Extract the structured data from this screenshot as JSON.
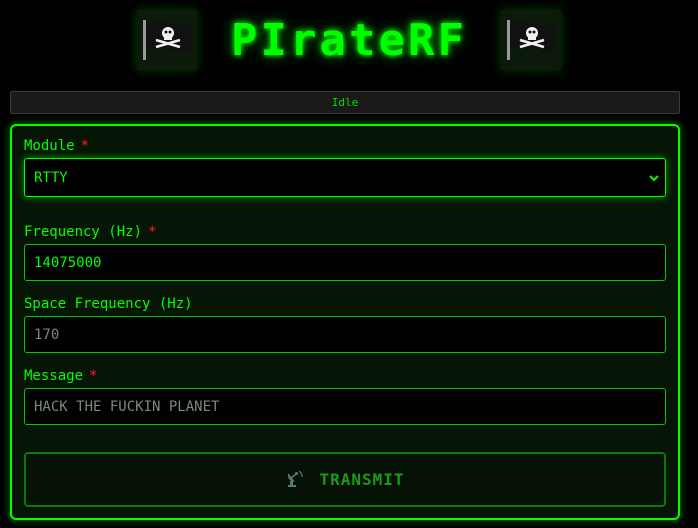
{
  "header": {
    "title": "PIrateRF",
    "left_icon": "pirate-flag-icon",
    "right_icon": "pirate-flag-icon"
  },
  "status": {
    "text": "Idle"
  },
  "form": {
    "module": {
      "label": "Module",
      "required_mark": "*",
      "selected": "RTTY"
    },
    "frequency": {
      "label": "Frequency (Hz)",
      "required_mark": "*",
      "value": "14075000"
    },
    "space_frequency": {
      "label": "Space Frequency (Hz)",
      "placeholder": "170"
    },
    "message": {
      "label": "Message",
      "required_mark": "*",
      "placeholder": "HACK THE FUCKIN PLANET"
    },
    "transmit_button": {
      "icon": "satellite-dish-icon",
      "label": "TRANSMIT"
    }
  },
  "colors": {
    "accent": "#00ff00",
    "required": "#ff2020",
    "background": "#000000"
  }
}
